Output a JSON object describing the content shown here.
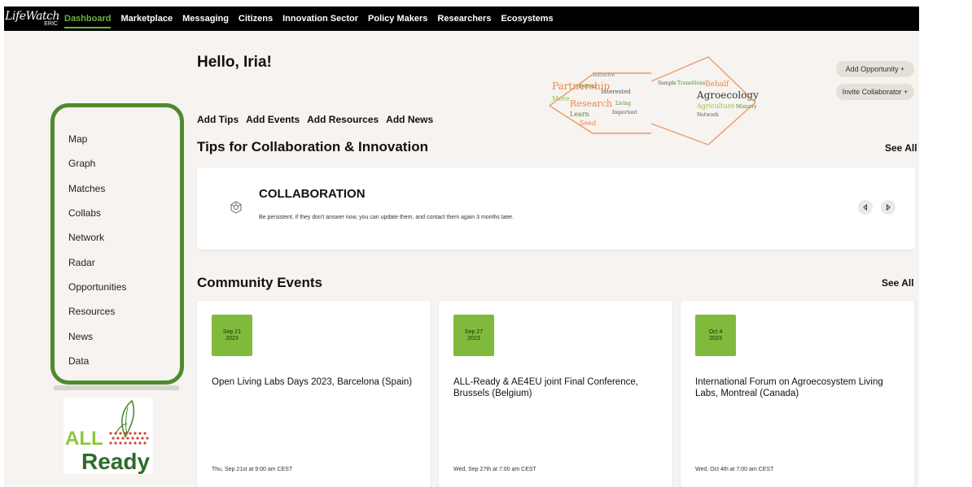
{
  "header": {
    "logo_main": "LifeWatch",
    "logo_sub": "ERIC",
    "nav": [
      {
        "label": "Dashboard",
        "active": true
      },
      {
        "label": "Marketplace"
      },
      {
        "label": "Messaging"
      },
      {
        "label": "Citizens"
      },
      {
        "label": "Innovation Sector"
      },
      {
        "label": "Policy Makers"
      },
      {
        "label": "Researchers"
      },
      {
        "label": "Ecosystems"
      }
    ]
  },
  "sidebar": {
    "items": [
      "Map",
      "Graph",
      "Matches",
      "Collabs",
      "Network",
      "Radar",
      "Opportunities",
      "Resources",
      "News",
      "Data"
    ]
  },
  "logo_all_ready": {
    "line1": "ALL",
    "line2": "Ready"
  },
  "greeting": "Hello, Iria!",
  "wordcloud": {
    "words": [
      "Partnership",
      "Research",
      "Agroecology",
      "Agriculture",
      "Learn",
      "Seed",
      "More",
      "Interested",
      "Network",
      "Ministry",
      "Important",
      "Behalf",
      "System",
      "Initiative",
      "Living",
      "Sample",
      "Transitions"
    ]
  },
  "actions": {
    "add_opportunity": "Add Opportunity +",
    "invite_collaborator": "Invite Collaborator +"
  },
  "quick_links": [
    "Add Tips",
    "Add Events",
    "Add Resources",
    "Add News"
  ],
  "tips": {
    "heading": "Tips for Collaboration & Innovation",
    "see_all": "See All",
    "card_title": "COLLABORATION",
    "card_text": "Be persistent, if they don't answer now, you can update them, and contact them again 3 months later."
  },
  "events": {
    "heading": "Community Events",
    "see_all": "See All",
    "items": [
      {
        "date_line1": "Sep 21",
        "date_line2": "2023",
        "title": "Open Living Labs Days 2023, Barcelona (Spain)",
        "time": "Thu, Sep 21st at 9:00 am CEST"
      },
      {
        "date_line1": "Sep 27",
        "date_line2": "2023",
        "title": "ALL-Ready & AE4EU joint Final Conference, Brussels (Belgium)",
        "time": "Wed, Sep 27th at 7:00 am CEST"
      },
      {
        "date_line1": "Oct 4",
        "date_line2": "2023",
        "title": "International Forum on Agroecosystem Living Labs, Montreal (Canada)",
        "time": "Wed, Oct 4th at 7:00 am CEST"
      }
    ]
  },
  "colors": {
    "accent_green": "#4f8a2f",
    "nav_active": "#6db33f",
    "date_badge": "#7fba3c",
    "background": "#f6f3f0"
  }
}
